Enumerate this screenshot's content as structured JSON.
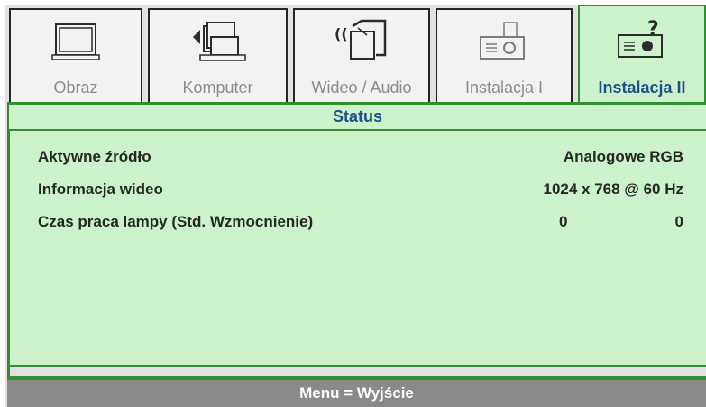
{
  "tabs": [
    {
      "label": "Obraz",
      "icon": "monitor-icon",
      "active": false
    },
    {
      "label": "Komputer",
      "icon": "computer-icon",
      "active": false
    },
    {
      "label": "Wideo / Audio",
      "icon": "video-audio-icon",
      "active": false
    },
    {
      "label": "Instalacja I",
      "icon": "projector-icon",
      "active": false
    },
    {
      "label": "Instalacja II",
      "icon": "projector-help-icon",
      "active": true
    }
  ],
  "section_title": "Status",
  "rows": [
    {
      "name": "Aktywne źródło",
      "value": "Analogowe RGB"
    },
    {
      "name": "Informacja wideo",
      "value": "1024 x 768  @ 60 Hz"
    },
    {
      "name": "Czas praca lampy (Std.  Wzmocnienie)",
      "value_a": "0",
      "value_b": "0"
    }
  ],
  "footer": "Menu = Wyjście",
  "colors": {
    "active_tab": "#ccf2cc",
    "border_green": "#2f8f2f",
    "title_blue": "#1d4f8a",
    "footer_gray": "#8a8a8a"
  }
}
